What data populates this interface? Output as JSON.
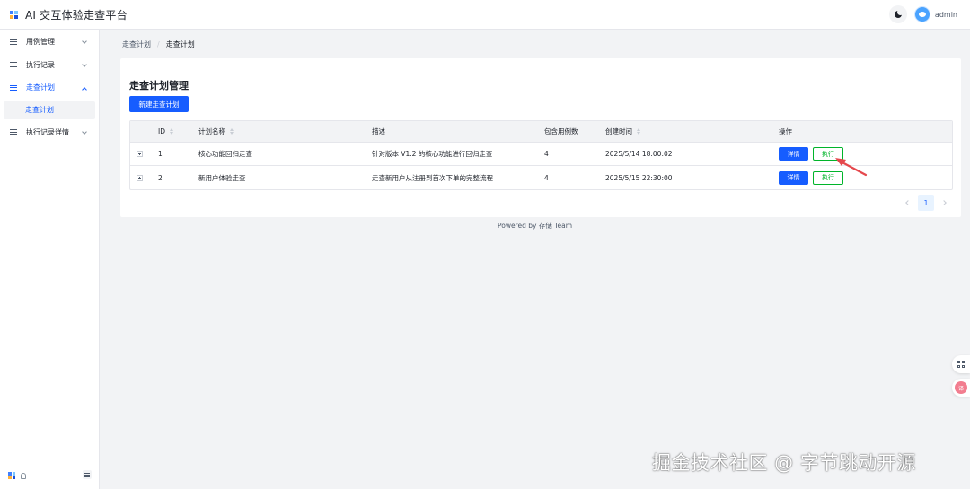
{
  "app": {
    "title": "AI 交互体验走查平台"
  },
  "header": {
    "user_name": "admin"
  },
  "sidebar": {
    "items": [
      {
        "label": "用例管理"
      },
      {
        "label": "执行记录"
      },
      {
        "label": "走查计划",
        "active": true,
        "children": [
          {
            "label": "走查计划"
          }
        ]
      },
      {
        "label": "执行记录详情"
      }
    ]
  },
  "breadcrumb": {
    "first": "走查计划",
    "second": "走查计划"
  },
  "page": {
    "title": "走查计划管理",
    "new_button": "新建走查计划"
  },
  "table": {
    "columns": [
      "ID",
      "计划名称",
      "描述",
      "包含用例数",
      "创建时间",
      "操作"
    ],
    "rows": [
      {
        "id": "1",
        "name": "核心功能回归走查",
        "desc": "针对版本 V1.2 的核心功能进行回归走查",
        "count": "4",
        "created": "2025/5/14 18:00:02",
        "detail": "详情",
        "exec": "执行"
      },
      {
        "id": "2",
        "name": "新用户体验走查",
        "desc": "走查新用户从注册到首次下单的完整流程",
        "count": "4",
        "created": "2025/5/15 22:30:00",
        "detail": "详情",
        "exec": "执行"
      }
    ]
  },
  "pagination": {
    "current_page": "1"
  },
  "footer": {
    "text": "Powered by 存储 Team"
  },
  "float_tools": {
    "translate_glyph": "译"
  },
  "watermark": "掘金技术社区 @ 字节跳动开源",
  "colors": {
    "primary": "#165dff",
    "success": "#00b42a",
    "annotation_arrow": "#e5484d"
  }
}
